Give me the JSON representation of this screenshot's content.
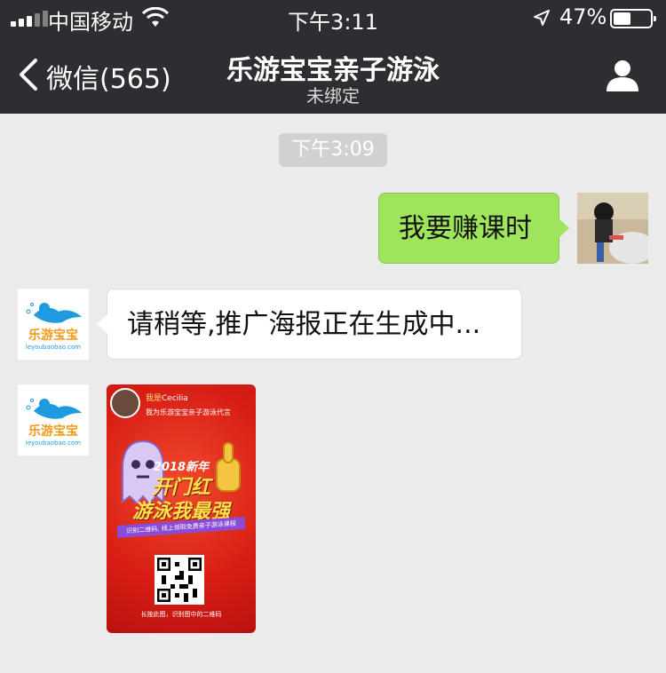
{
  "status_bar": {
    "carrier": "中国移动",
    "time": "下午3:11",
    "battery_percent": "47%",
    "battery_level": 0.47
  },
  "nav": {
    "back_label": "微信(565)",
    "title": "乐游宝宝亲子游泳",
    "subtitle": "未绑定"
  },
  "chat": {
    "timestamp": "下午3:09",
    "messages": [
      {
        "side": "sent",
        "text": "我要赚课时"
      },
      {
        "side": "received",
        "text": "请稍等,推广海报正在生成中..."
      }
    ],
    "poster": {
      "top_line_prefix": "我是",
      "top_line_name": "Cecilia",
      "sub_line": "我为乐游宝宝亲子游泳代言",
      "headline1": "2018新年",
      "headline2": "开门红",
      "headline3": "游泳我最强",
      "strip_text": "识别二维码, 线上领取免费亲子游泳课程",
      "bottom_text": "长按此图，识别图中的二维码"
    },
    "bot_logo": {
      "name": "乐游宝宝",
      "url_text": "leyoubaobao.com"
    }
  },
  "colors": {
    "header_bg": "#2e2e32",
    "chat_bg": "#ebebeb",
    "sent_bubble": "#9fe55b",
    "received_bubble": "#ffffff",
    "poster_red": "#d81d14"
  },
  "icons": {
    "back": "chevron-left-icon",
    "profile": "person-icon",
    "wifi": "wifi-icon",
    "location": "location-arrow-icon",
    "battery": "battery-icon"
  }
}
